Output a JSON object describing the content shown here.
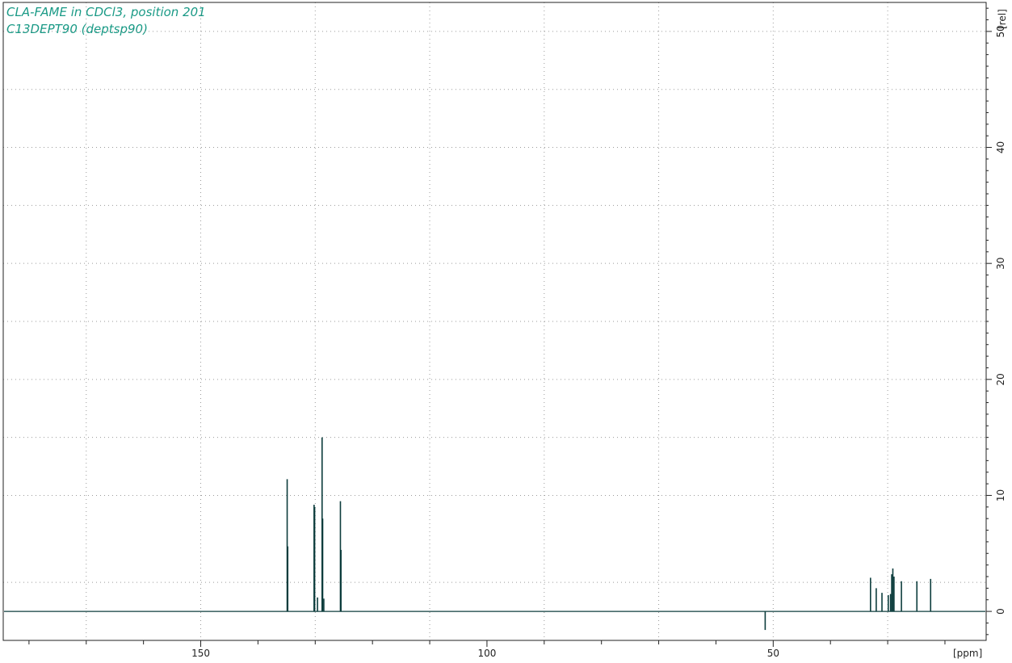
{
  "title_lines": [
    "CLA-FAME in CDCl3, position 201",
    "C13DEPT90 (deptsp90)"
  ],
  "colors": {
    "spectrum": "#0d3d3d",
    "title": "#1a9a86",
    "grid": "#9a9a9a",
    "frame": "#222222"
  },
  "chart_data": {
    "type": "line",
    "xlabel": "[ppm]",
    "ylabel": "[rel]",
    "xlim": [
      184.5,
      12.8
    ],
    "ylim": [
      -2.5,
      52.5
    ],
    "x_axis_reversed": true,
    "grid": true,
    "x_major_ticks": [
      150,
      100,
      50
    ],
    "x_tick_labels": [
      "150",
      "100",
      "50"
    ],
    "x_minor_ticks": [
      180,
      170,
      160,
      140,
      130,
      120,
      110,
      90,
      80,
      70,
      60,
      40,
      30,
      20
    ],
    "x_grid": [
      170,
      150,
      130,
      110,
      90,
      70,
      50,
      30
    ],
    "y_major_ticks": [
      0,
      10,
      20,
      30,
      40,
      50
    ],
    "y_tick_labels": [
      "0",
      "10",
      "20",
      "30",
      "40",
      "50"
    ],
    "y_grid": [
      2.5,
      10,
      15,
      20,
      25,
      30,
      35,
      40,
      45,
      50
    ],
    "series": [
      {
        "baseline": 0,
        "peaks": [
          {
            "x": 134.9,
            "y": 11.4
          },
          {
            "x": 134.8,
            "y": 5.6
          },
          {
            "x": 130.2,
            "y": 9.2
          },
          {
            "x": 130.1,
            "y": 9.0
          },
          {
            "x": 129.6,
            "y": 1.2
          },
          {
            "x": 128.8,
            "y": 15.0
          },
          {
            "x": 128.7,
            "y": 8.0
          },
          {
            "x": 128.5,
            "y": 1.1
          },
          {
            "x": 125.6,
            "y": 9.5
          },
          {
            "x": 125.5,
            "y": 5.3
          },
          {
            "x": 51.4,
            "y": -1.6
          },
          {
            "x": 33.0,
            "y": 2.9
          },
          {
            "x": 32.0,
            "y": 2.0
          },
          {
            "x": 31.0,
            "y": 1.6
          },
          {
            "x": 29.9,
            "y": 1.4
          },
          {
            "x": 29.5,
            "y": 1.5
          },
          {
            "x": 29.3,
            "y": 3.2
          },
          {
            "x": 29.1,
            "y": 3.7
          },
          {
            "x": 28.9,
            "y": 3.0
          },
          {
            "x": 27.6,
            "y": 2.6
          },
          {
            "x": 24.9,
            "y": 2.6
          },
          {
            "x": 22.5,
            "y": 2.8
          }
        ]
      }
    ]
  }
}
